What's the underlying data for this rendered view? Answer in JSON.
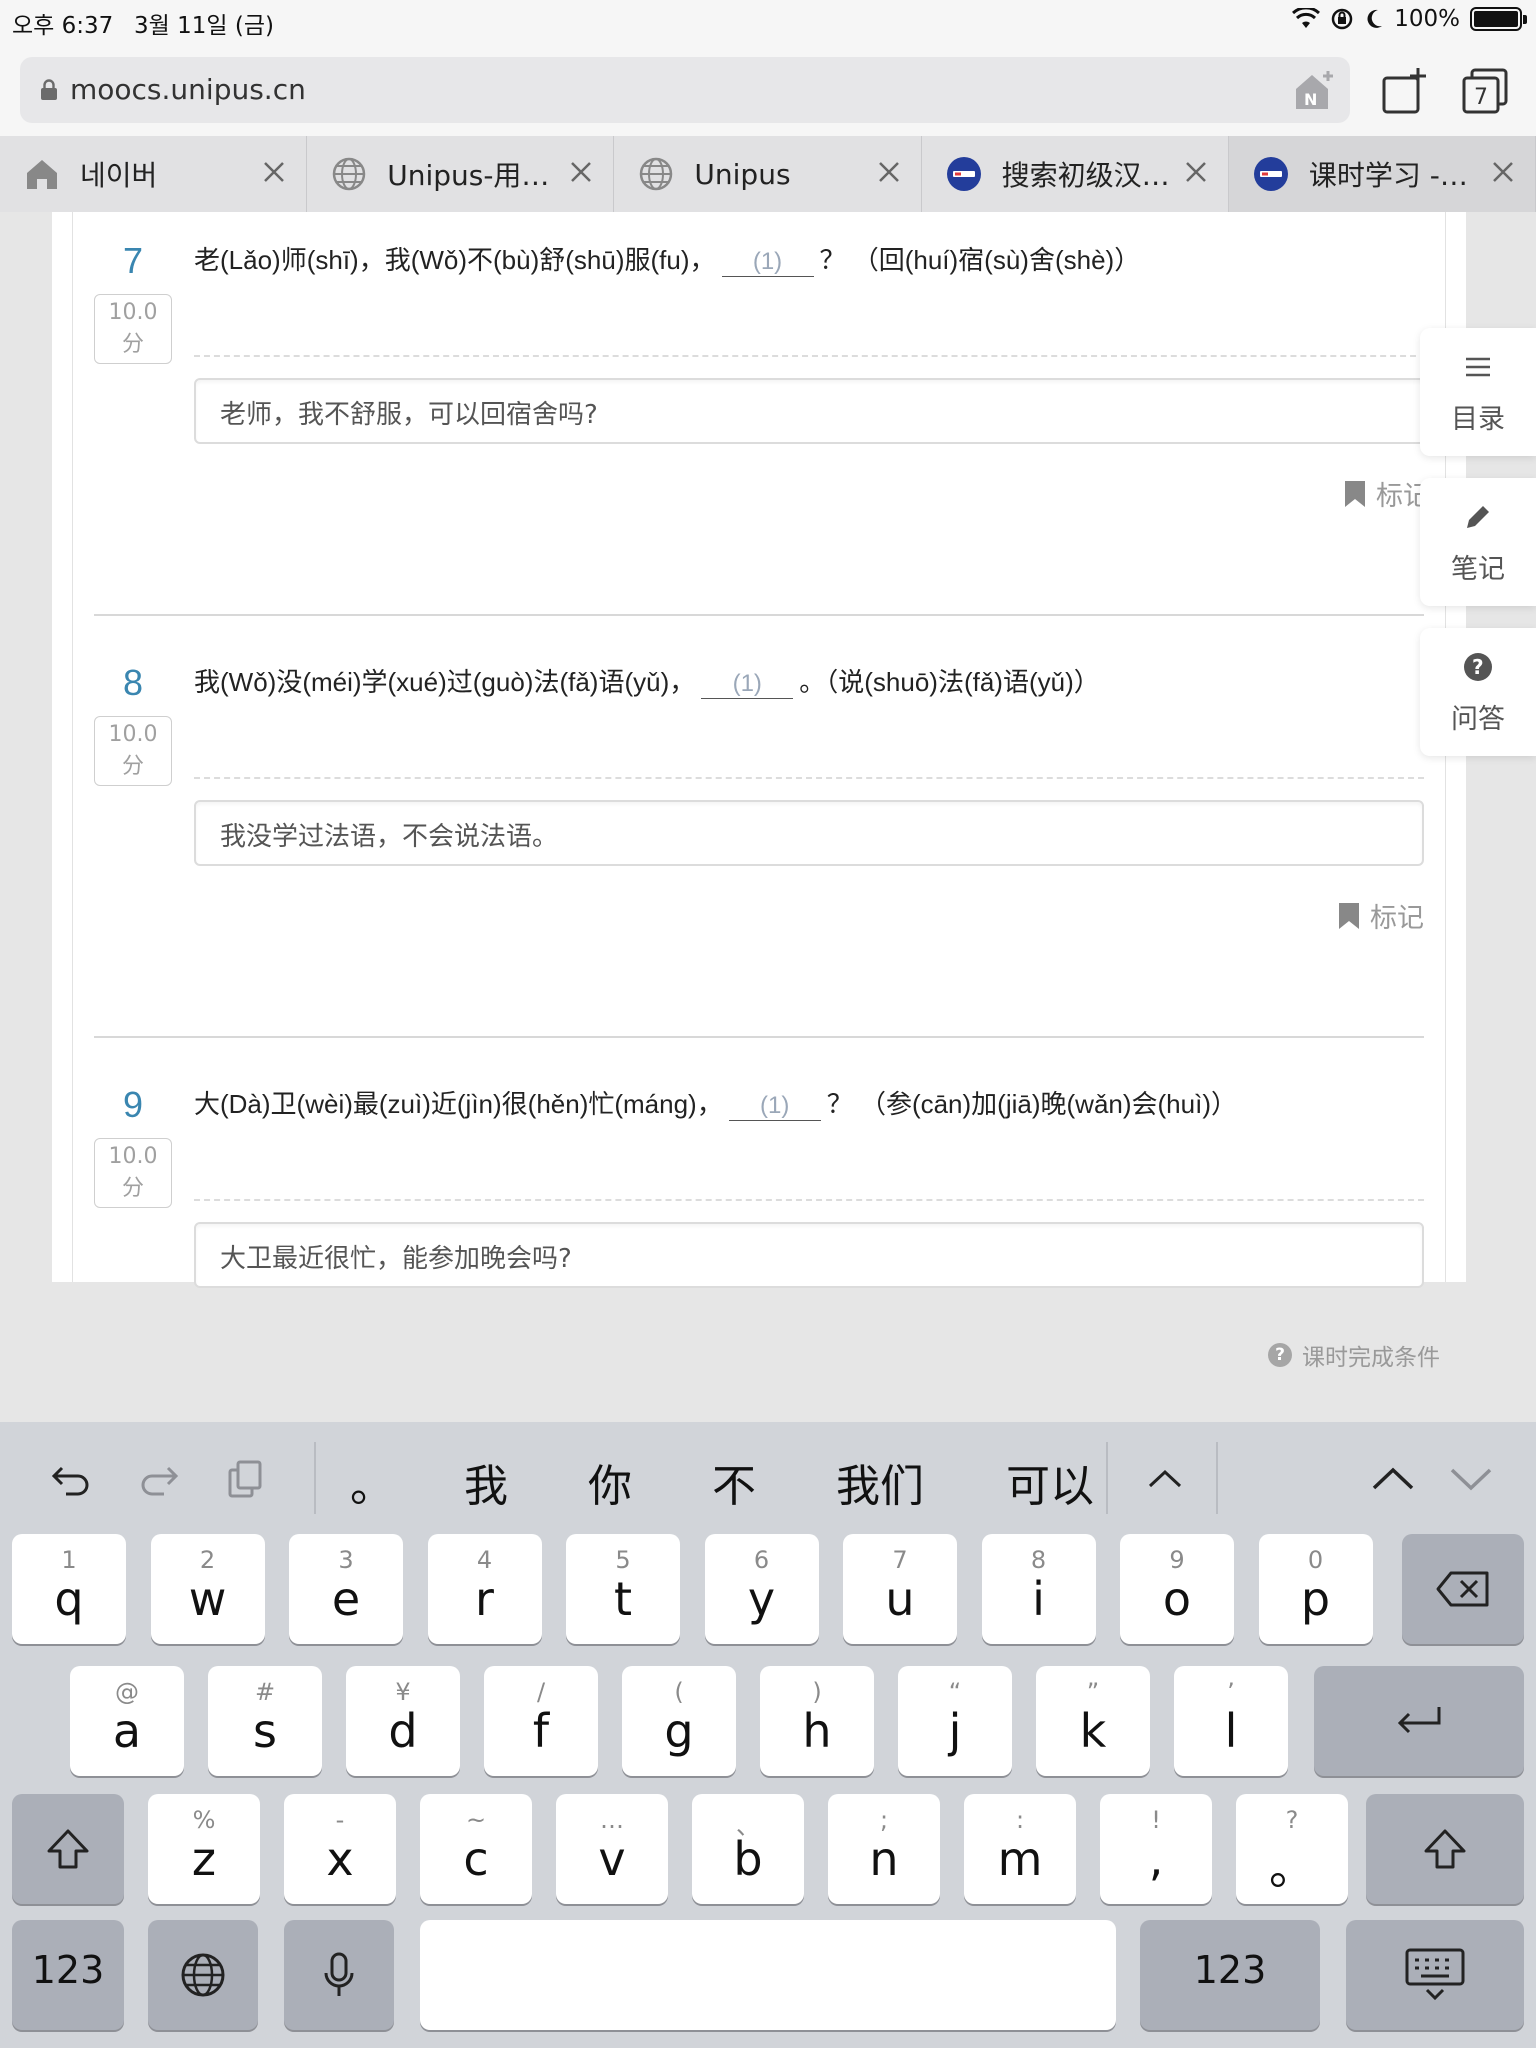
{
  "status_bar": {
    "time": "오후 6:37",
    "date": "3월 11일 (금)",
    "battery": "100%",
    "battery_level": 1.0
  },
  "address_bar": {
    "url": "moocs.unipus.cn"
  },
  "tabs": [
    {
      "label": "네이버",
      "icon": "home-icon"
    },
    {
      "label": "Unipus-用…",
      "icon": "globe-icon"
    },
    {
      "label": "Unipus",
      "icon": "globe-icon"
    },
    {
      "label": "搜索初级汉…",
      "icon": "unipus-logo-icon"
    },
    {
      "label": "课时学习 -…",
      "icon": "unipus-logo-icon"
    }
  ],
  "tab_count": "7",
  "questions": [
    {
      "number": "7",
      "score": "10.0",
      "score_unit": "分",
      "prompt_before": "老(Lǎo)师(shī)，我(Wǒ)不(bù)舒(shū)服(fu)，",
      "blank": "(1)",
      "prompt_after": "？ （回(huí)宿(sù)舍(shè)）",
      "answer": "老师，我不舒服，可以回宿舍吗?",
      "mark_label": "标记"
    },
    {
      "number": "8",
      "score": "10.0",
      "score_unit": "分",
      "prompt_before": "我(Wǒ)没(méi)学(xué)过(guò)法(fǎ)语(yǔ)，",
      "blank": "(1)",
      "prompt_after": "。（说(shuō)法(fǎ)语(yǔ)）",
      "answer": "我没学过法语，不会说法语。",
      "mark_label": "标记"
    },
    {
      "number": "9",
      "score": "10.0",
      "score_unit": "分",
      "prompt_before": "大(Dà)卫(wèi)最(zuì)近(jìn)很(hěn)忙(máng)，",
      "blank": "(1)",
      "prompt_after": "？ （参(cān)加(jiā)晚(wǎn)会(huì)）",
      "answer": "大卫最近很忙，能参加晚会吗?"
    }
  ],
  "side_buttons": {
    "catalog": "目录",
    "notes": "笔记",
    "qa": "问答"
  },
  "completion_label": "课时完成条件",
  "keyboard": {
    "candidates": [
      "。",
      "我",
      "你",
      "不",
      "我们",
      "可以"
    ],
    "row1": [
      {
        "hint": "1",
        "key": "q"
      },
      {
        "hint": "2",
        "key": "w"
      },
      {
        "hint": "3",
        "key": "e"
      },
      {
        "hint": "4",
        "key": "r"
      },
      {
        "hint": "5",
        "key": "t"
      },
      {
        "hint": "6",
        "key": "y"
      },
      {
        "hint": "7",
        "key": "u"
      },
      {
        "hint": "8",
        "key": "i"
      },
      {
        "hint": "9",
        "key": "o"
      },
      {
        "hint": "0",
        "key": "p"
      }
    ],
    "row2": [
      {
        "hint": "@",
        "key": "a"
      },
      {
        "hint": "#",
        "key": "s"
      },
      {
        "hint": "¥",
        "key": "d"
      },
      {
        "hint": "/",
        "key": "f"
      },
      {
        "hint": "(",
        "key": "g"
      },
      {
        "hint": ")",
        "key": "h"
      },
      {
        "hint": "“",
        "key": "j"
      },
      {
        "hint": "”",
        "key": "k"
      },
      {
        "hint": "’",
        "key": "l"
      }
    ],
    "row3": [
      {
        "hint": "%",
        "key": "z"
      },
      {
        "hint": "-",
        "key": "x"
      },
      {
        "hint": "~",
        "key": "c"
      },
      {
        "hint": "…",
        "key": "v"
      },
      {
        "hint": "、",
        "key": "b"
      },
      {
        "hint": ";",
        "key": "n"
      },
      {
        "hint": ":",
        "key": "m"
      },
      {
        "hint": "!",
        "key": ","
      },
      {
        "hint": "?",
        "key": "。"
      }
    ],
    "num_label": "123"
  }
}
